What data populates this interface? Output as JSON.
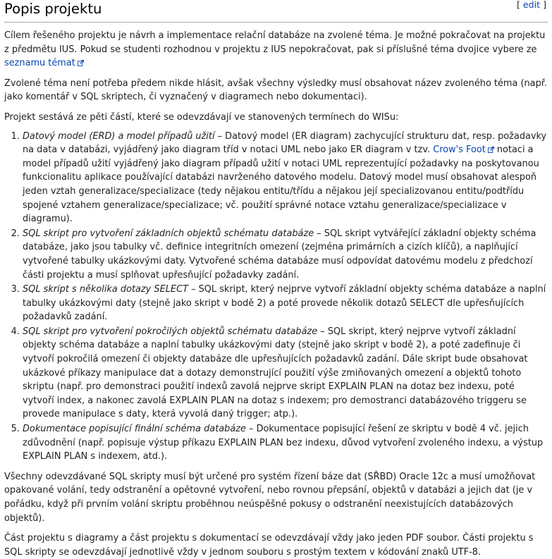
{
  "section": {
    "title": "Popis projektu",
    "edit_open": "[ ",
    "edit_label": "edit",
    "edit_close": " ]"
  },
  "intro": {
    "text_before_link": "Cílem řešeného projektu je návrh a implementace relační databáze na zvolené téma. Je možné pokračovat na projektu z předmětu IUS. Pokud se studenti rozhodnou v projektu z IUS nepokračovat, pak si příslušné téma dvojice vybere ze ",
    "link_label": "seznamu témat",
    "text_after_link": ""
  },
  "para2": "Zvolené téma není potřeba předem nikde hlásit, avšak všechny výsledky musí obsahovat název zvoleného téma (např. jako komentář v SQL skriptech, či vyznačený v diagramech nebo dokumentaci).",
  "para3": "Projekt sestává ze pěti částí, které se odevzdávají ve stanovených termínech do WISu:",
  "items": [
    {
      "title": "Datový model (ERD) a model případů užití",
      "before_link": " – Datový model (ER diagram) zachycující strukturu dat, resp. požadavky na data v databázi, vyjádřený jako diagram tříd v notaci UML nebo jako ER diagram v tzv. ",
      "link_label": "Crow's Foot",
      "after_link": " notaci a model případů užití vyjádřený jako diagram případů užití v notaci UML reprezentující požadavky na poskytovanou funkcionalitu aplikace používající databázi navrženého datového modelu. Datový model musí obsahovat alespoň jeden vztah generalizace/specializace (tedy nějakou entitu/třídu a nějakou její specializovanou entitu/podtřídu spojené vztahem generalizace/specializace; vč. použití správné notace vztahu generalizace/specializace v diagramu)."
    },
    {
      "title": "SQL skript pro vytvoření základních objektů schématu databáze",
      "text": " – SQL skript vytvářející základní objekty schéma databáze, jako jsou tabulky vč. definice integritních omezení (zejména primárních a cizích klíčů), a naplňující vytvořené tabulky ukázkovými daty. Vytvořené schéma databáze musí odpovídat datovému modelu z předchozí části projektu a musí splňovat upřesňující požadavky zadání."
    },
    {
      "title": "SQL skript s několika dotazy SELECT",
      "text": " – SQL skript, který nejprve vytvoří základní objekty schéma databáze a naplní tabulky ukázkovými daty (stejně jako skript v bodě 2) a poté provede několik dotazů SELECT dle upřesňujících požadavků zadání."
    },
    {
      "title": "SQL skript pro vytvoření pokročilých objektů schématu databáze",
      "text": " – SQL skript, který nejprve vytvoří základní objekty schéma databáze a naplní tabulky ukázkovými daty (stejně jako skript v bodě 2), a poté zadefinuje či vytvoří pokročilá omezení či objekty databáze dle upřesňujících požadavků zadání. Dále skript bude obsahovat ukázkové příkazy manipulace dat a dotazy demonstrující použití výše zmiňovaných omezení a objektů tohoto skriptu (např. pro demonstraci použití indexů zavolá nejprve skript EXPLAIN PLAN na dotaz bez indexu, poté vytvoří index, a nakonec zavolá EXPLAIN PLAN na dotaz s indexem; pro demostranci databázového triggeru se provede manipulace s daty, která vyvolá daný trigger; atp.)."
    },
    {
      "title": "Dokumentace popisující finální schéma databáze",
      "text": " – Dokumentace popisující řešení ze skriptu v bodě 4 vč. jejich zdůvodnění (např. popisuje výstup příkazu EXPLAIN PLAN bez indexu, důvod vytvoření zvoleného indexu, a výstup EXPLAIN PLAN s indexem, atd.)."
    }
  ],
  "para4": "Všechny odevzdávané SQL skripty musí být určené pro systém řízení báze dat (SŘBD) Oracle 12c a musí umožňovat opakované volání, tedy odstranění a opětovné vytvoření, nebo rovnou přepsání, objektů v databázi a jejich dat (je v pořádku, když při prvním volání skriptu proběhnou neúspěšné pokusy o odstranění neexistujících databázových objektů).",
  "para5": "Část projektu s diagramy a část projektu s dokumentací se odevzdávají vždy jako jeden PDF soubor. Části projektu s SQL skripty se odevzdávají jednotlivě vždy v jednom souboru s prostým textem v kódování znaků UTF-8.",
  "colors": {
    "link": "#0645ad",
    "text": "#202122",
    "rule": "#a2a9b1"
  },
  "icons": {
    "external_link": "external-link-icon"
  }
}
